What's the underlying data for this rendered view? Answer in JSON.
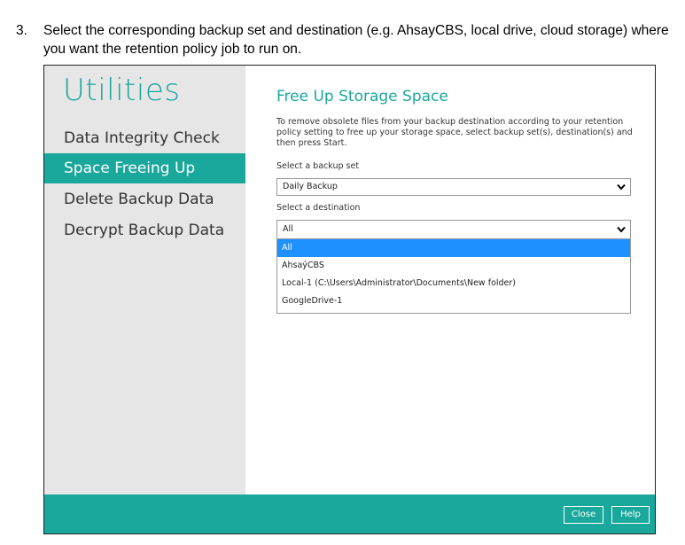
{
  "instruction": {
    "number": "3.",
    "text": "Select the corresponding backup set and destination (e.g. AhsayCBS, local drive, cloud storage) where you want the retention policy job to run on."
  },
  "sidebar": {
    "title": "Utilities",
    "items": [
      {
        "label": "Data Integrity Check"
      },
      {
        "label": "Space Freeing Up"
      },
      {
        "label": "Delete Backup Data"
      },
      {
        "label": "Decrypt Backup Data"
      }
    ],
    "active_item": "Space Freeing Up"
  },
  "main": {
    "heading": "Free Up Storage Space",
    "description": "To remove obsolete files from your backup destination according to your retention policy setting to free up your storage space, select backup set(s), destination(s) and then press Start.",
    "backup_set_label": "Select a backup set",
    "backup_set_value": "Daily Backup",
    "destination_label": "Select a destination",
    "destination_value": "All",
    "destination_options": [
      "All",
      "AhsaýCBS",
      "Local-1 (C:\\Users\\Administrator\\Documents\\New folder)",
      "GoogleDrive-1"
    ],
    "highlighted_option": "All"
  },
  "footer": {
    "close_label": "Close",
    "help_label": "Help"
  },
  "colors": {
    "accent": "#1aa79c",
    "sidebar_bg": "#e6e6e6",
    "selection": "#1e90ff"
  }
}
